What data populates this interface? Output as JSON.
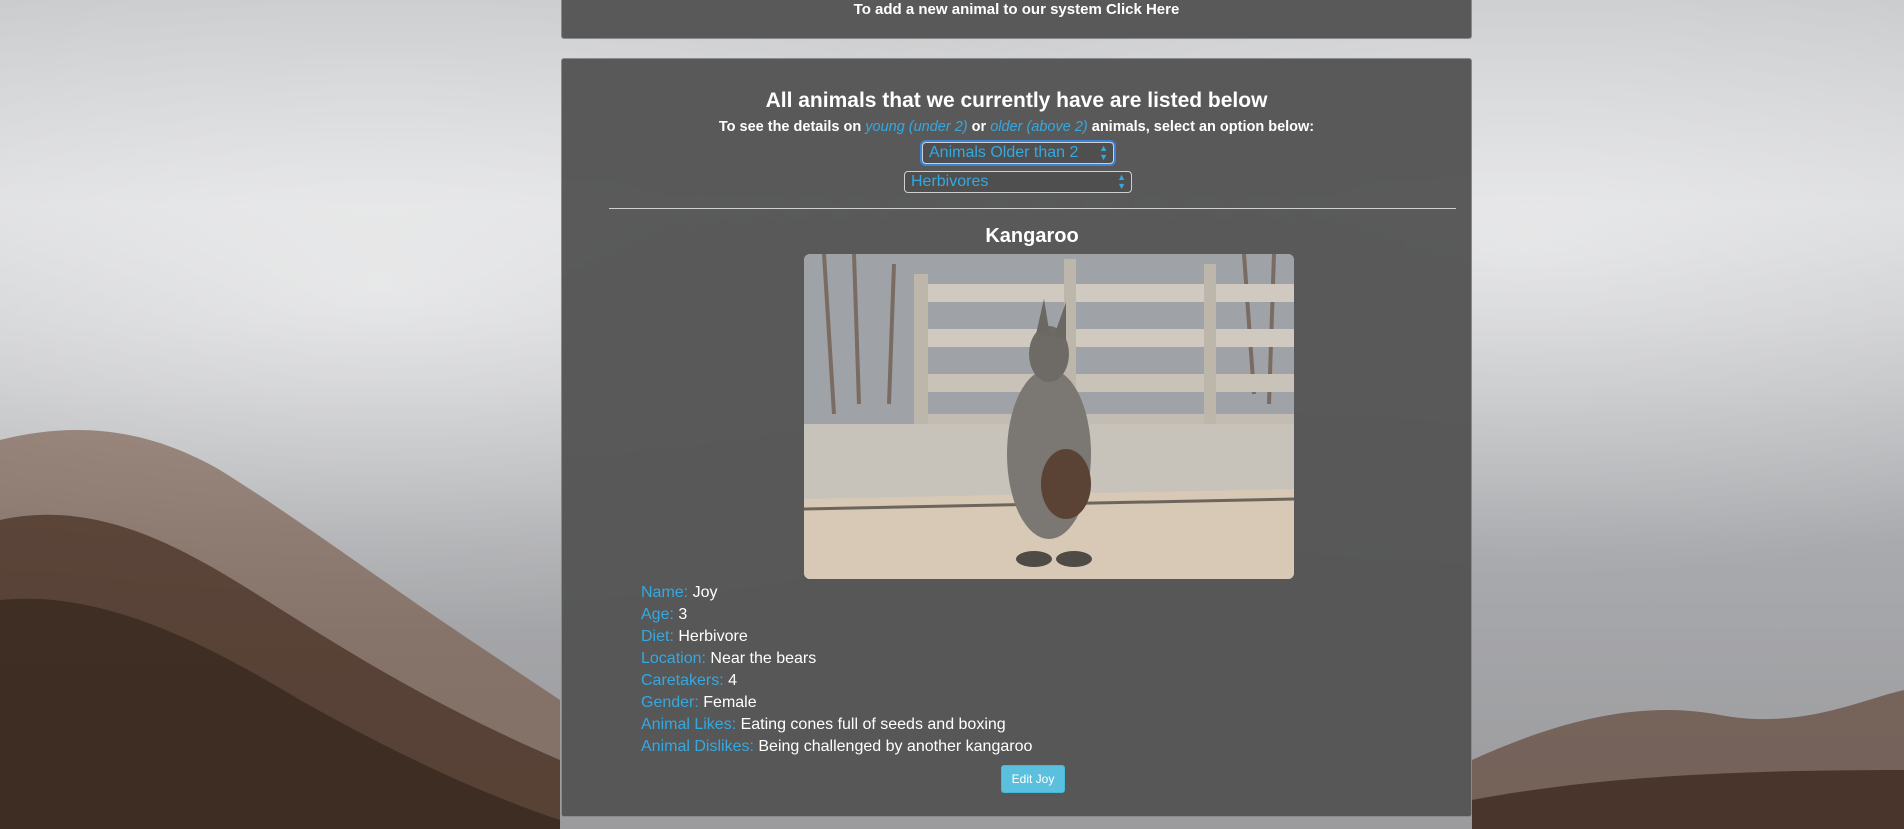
{
  "top_panel": {
    "add_link": "To add a new animal to our system Click Here"
  },
  "main": {
    "heading": "All animals that we currently have are listed below",
    "sub_prefix": "To see the details on",
    "sub_young": "young (under 2)",
    "sub_or": "or",
    "sub_older": "older (above 2)",
    "sub_suffix": "animals, select an option below:",
    "age_select": {
      "selected": "Animals Older than 2"
    },
    "diet_select": {
      "selected": "Herbivores"
    }
  },
  "animal": {
    "species": "Kangaroo",
    "photo_alt": "kangaroo-photo",
    "details": [
      {
        "label": "Name:",
        "value": "Joy"
      },
      {
        "label": "Age:",
        "value": "3"
      },
      {
        "label": "Diet:",
        "value": "Herbivore"
      },
      {
        "label": "Location:",
        "value": "Near the bears"
      },
      {
        "label": "Caretakers:",
        "value": "4"
      },
      {
        "label": "Gender:",
        "value": "Female"
      },
      {
        "label": "Animal Likes:",
        "value": "Eating cones full of seeds and boxing"
      },
      {
        "label": "Animal Dislikes:",
        "value": "Being challenged by another kangaroo"
      }
    ],
    "edit_button": "Edit Joy"
  },
  "colors": {
    "accent": "#35a8e0",
    "panel": "#555555",
    "button": "#5bc0de"
  }
}
